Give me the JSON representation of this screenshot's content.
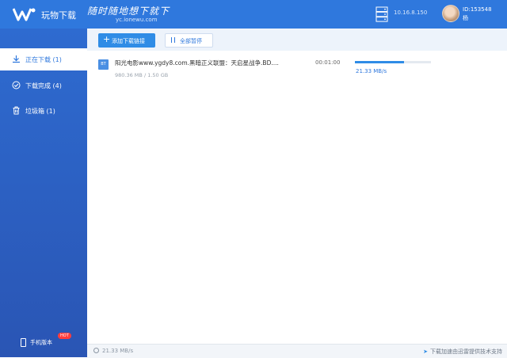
{
  "header": {
    "app_name": "玩物下载",
    "slogan": "随时随地想下就下",
    "slogan_url": "yc.ionewu.com",
    "server_ip": "10.16.8.150",
    "user_id": "ID:153548",
    "user_name": "杨",
    "icons": [
      "wanwu-logo-icon",
      "server-icon",
      "avatar"
    ]
  },
  "sidebar": {
    "items": [
      {
        "label": "正在下载 (1)",
        "icon": "download-icon",
        "active": true
      },
      {
        "label": "下载完成 (4)",
        "icon": "check-circle-icon",
        "active": false
      },
      {
        "label": "垃圾箱 (1)",
        "icon": "trash-icon",
        "active": false
      }
    ],
    "mobile_label": "手机版本",
    "hot_badge": "HOT"
  },
  "toolbar": {
    "add_label": "添加下载链接",
    "pause_all_label": "全部暂停"
  },
  "tasks": [
    {
      "type_badge": "BT",
      "name": "阳光电影www.ygdy8.com.黑暗正义联盟：天启星战争.BD....",
      "size": "980.36 MB / 1.50 GB",
      "time_left": "00:01:00",
      "progress": 0.65,
      "speed": "21.33 MB/s"
    }
  ],
  "status_bar": {
    "total_speed": "21.33 MB/s",
    "powered_by": "下载加速由迅雷提供技术支持"
  },
  "colors": {
    "brand_blue": "#2f78dd",
    "sidebar_top": "#2e6bd0",
    "sidebar_bottom": "#2a55b4",
    "progress": "#2f8ce6",
    "hot": "#ff3c3c"
  }
}
